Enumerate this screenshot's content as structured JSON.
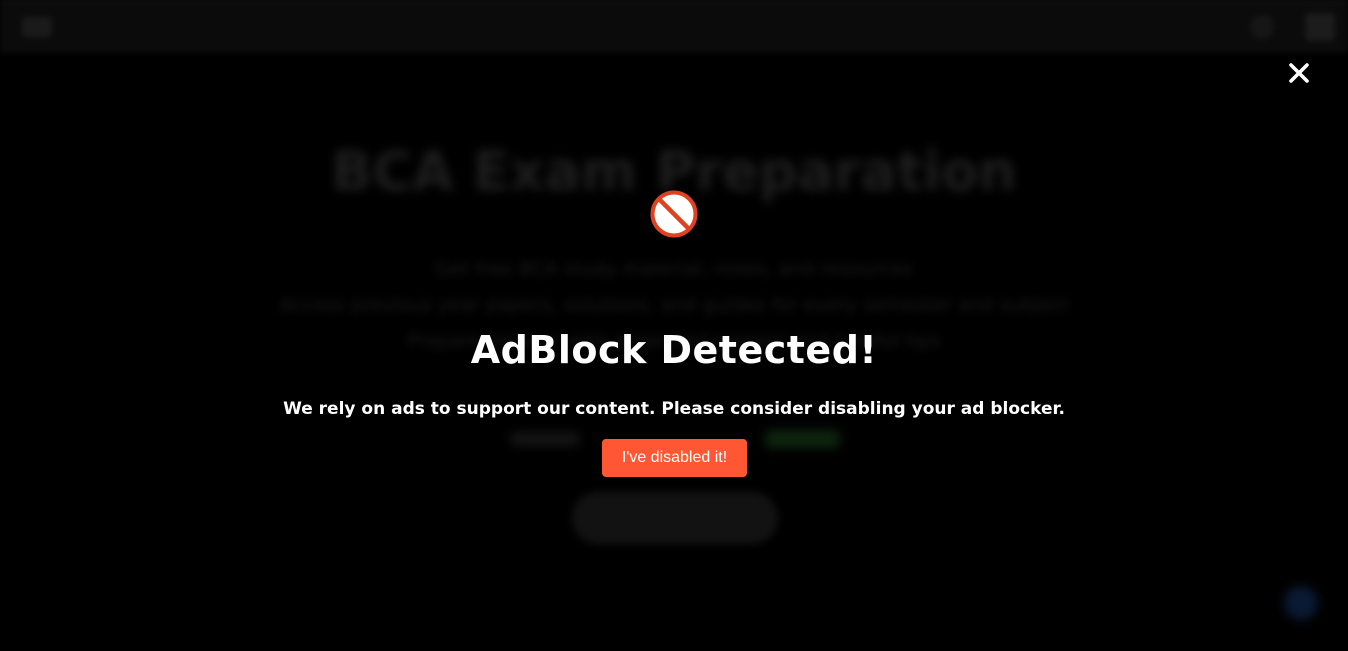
{
  "background": {
    "heading": "BCA Exam Preparation",
    "lines": [
      "Get free BCA study material, notes, and resources",
      "Access previous year papers, solutions, and guides for every semester and subject",
      "Prepare smarter with organized content and helpful tips"
    ]
  },
  "modal": {
    "close_icon": "close-icon",
    "blocked_icon": "blocked-icon",
    "title": "AdBlock Detected!",
    "message": "We rely on ads to support our content. Please consider disabling your ad blocker.",
    "button_label": "I've disabled it!",
    "colors": {
      "button": "#ff5733",
      "blocked_icon": "#e0411f",
      "overlay": "#000000"
    }
  }
}
